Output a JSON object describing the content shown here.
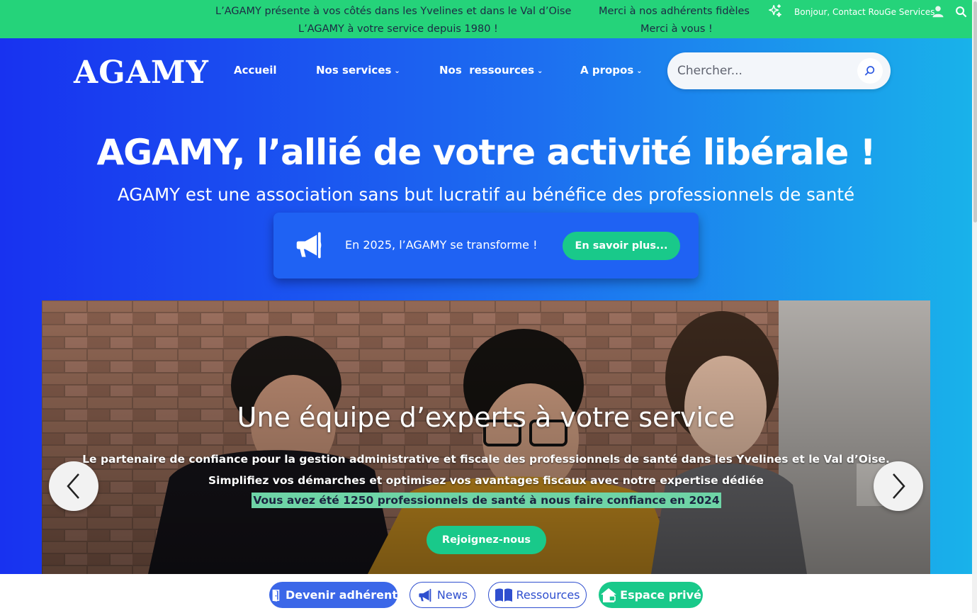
{
  "topbar": {
    "message_1": "L’AGAMY présente à vos côtés dans les Yvelines et dans le Val d’Oise",
    "message_2": "L’AGAMY à votre service depuis 1980 !",
    "message_3": "Merci à nos adhérents fidèles",
    "message_4": "Merci à vous !",
    "greeting": "Bonjour, Contact RouGe Services",
    "icons": [
      "sparkle-icon",
      "user-icon",
      "search-icon"
    ],
    "background": "#25d37a"
  },
  "header": {
    "logo": "AGAMY",
    "nav": [
      {
        "label": "Accueil"
      },
      {
        "label": "Nos services"
      },
      {
        "label": "Nos  ressources"
      },
      {
        "label": "A propos"
      }
    ],
    "search": {
      "placeholder": "Chercher..."
    }
  },
  "hero": {
    "title": "AGAMY, l’allié de votre activité libérale !",
    "subtitle": "AGAMY est une association sans but lucratif au bénéfice des professionnels de santé",
    "announcement": {
      "text": "En 2025, l’AGAMY se transforme !",
      "button": "En savoir plus...",
      "icon": "megaphone-icon"
    }
  },
  "slider": {
    "title": "Une équipe d’experts à votre service",
    "line_1": "Le partenaire de confiance pour la gestion administrative et fiscale des professionnels de santé dans les Yvelines et le Val d’Oise.",
    "line_2": "Simplifiez vos démarches et optimisez vos avantages fiscaux avec notre expertise dédiée",
    "highlight": "Vous avez été 1250 professionnels de santé à nous faire confiance en 2024",
    "button": "Rejoignez-nous"
  },
  "bottombar": {
    "buttons": [
      {
        "label": "Devenir adhérent",
        "icon": "door-icon"
      },
      {
        "label": "News",
        "icon": "megaphone-icon"
      },
      {
        "label": "Ressources",
        "icon": "book-icon"
      },
      {
        "label": "Espace privé",
        "icon": "house-lock-icon"
      }
    ]
  },
  "colors": {
    "accent_green": "#19c98a",
    "hero_gradient_start": "#1832f0",
    "hero_gradient_end": "#19b2ea",
    "highlight_bg": "#6ed4a6"
  }
}
